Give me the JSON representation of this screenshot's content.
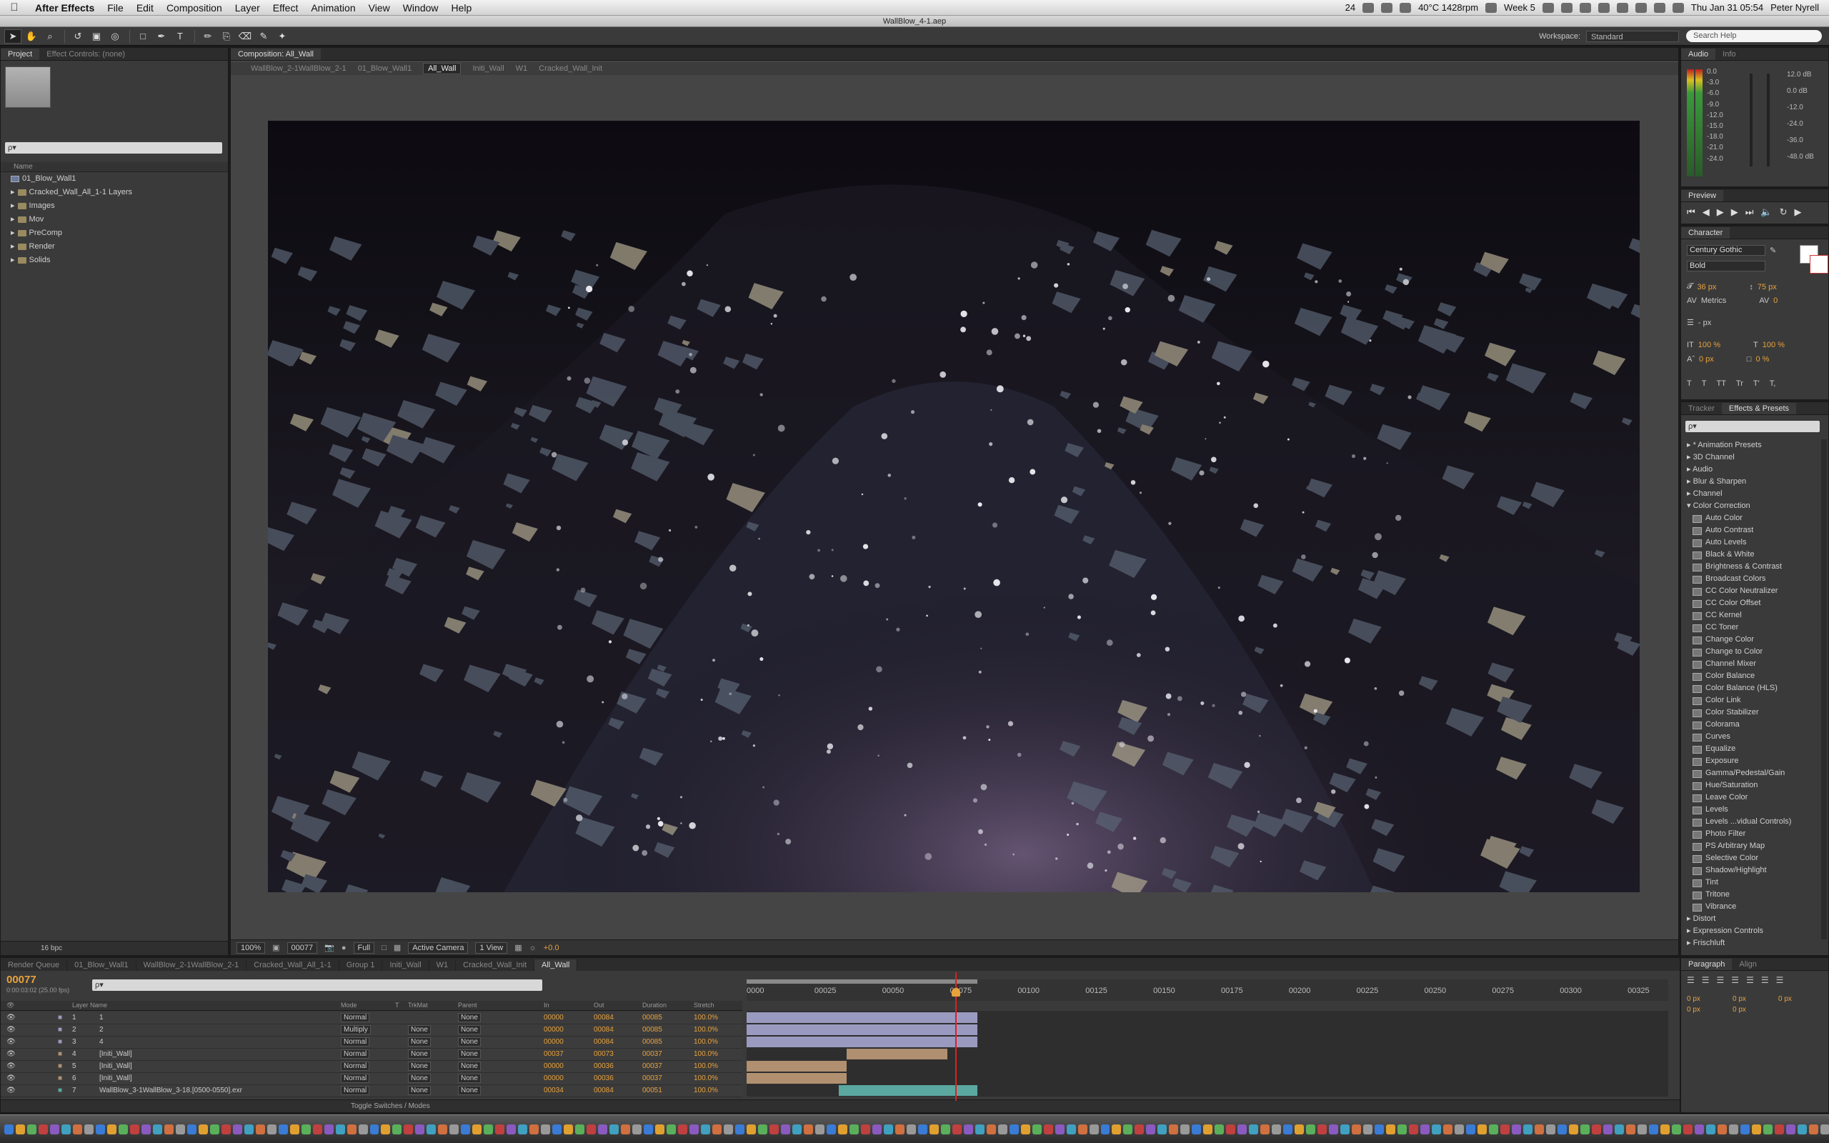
{
  "menubar": {
    "app_name": "After Effects",
    "items": [
      "File",
      "Edit",
      "Composition",
      "Layer",
      "Effect",
      "Animation",
      "View",
      "Window",
      "Help"
    ],
    "status": {
      "ai_count": "24",
      "temp": "40°C 1428rpm",
      "week": "Week 5",
      "datetime": "Thu Jan 31  05:54",
      "user": "Peter Nyrell"
    }
  },
  "window_title": "WallBlow_4-1.aep",
  "toolbar": {
    "workspace_label": "Workspace:",
    "workspace_value": "Standard",
    "help_placeholder": "Search Help"
  },
  "project": {
    "tabs": [
      "Project",
      "Effect Controls: (none)"
    ],
    "search_placeholder": "ρ▾",
    "column_name": "Name",
    "items": [
      {
        "label": "01_Blow_Wall1",
        "type": "comp"
      },
      {
        "label": "Cracked_Wall_All_1-1 Layers",
        "type": "folder"
      },
      {
        "label": "Images",
        "type": "folder"
      },
      {
        "label": "Mov",
        "type": "folder"
      },
      {
        "label": "PreComp",
        "type": "folder"
      },
      {
        "label": "Render",
        "type": "folder"
      },
      {
        "label": "Solids",
        "type": "folder"
      }
    ],
    "bpc": "16 bpc"
  },
  "comp": {
    "tab": "Composition: All_Wall",
    "breadcrumbs": [
      "WallBlow_2-1WallBlow_2-1",
      "01_Blow_Wall1",
      "All_Wall",
      "Initi_Wall",
      "W1",
      "Cracked_Wall_Init"
    ],
    "current_crumb": "All_Wall",
    "footer": {
      "zoom": "100%",
      "timecode": "00077",
      "resolution": "Full",
      "camera": "Active Camera",
      "views": "1 View",
      "exposure": "+0.0"
    }
  },
  "audio": {
    "tabs": [
      "Audio",
      "Info"
    ],
    "left_scale": [
      "0.0",
      "-3.0",
      "-6.0",
      "-9.0",
      "-12.0",
      "-15.0",
      "-18.0",
      "-21.0",
      "-24.0"
    ],
    "right_scale": [
      "12.0 dB",
      "0.0 dB",
      "-12.0",
      "-24.0",
      "-36.0",
      "-48.0 dB"
    ]
  },
  "preview": {
    "tab": "Preview"
  },
  "character": {
    "tab": "Character",
    "font": "Century Gothic",
    "style": "Bold",
    "size": "36 px",
    "leading": "75 px",
    "kerning": "Metrics",
    "tracking": "0",
    "stroke_width": "- px",
    "vscale": "100 %",
    "hscale": "100 %",
    "baseline": "0 px",
    "tsume": "0 %",
    "styles": [
      "T",
      "T",
      "TT",
      "Tr",
      "T'",
      "T,"
    ]
  },
  "effects": {
    "tabs": [
      "Tracker",
      "Effects & Presets"
    ],
    "search_placeholder": "ρ▾",
    "items": [
      {
        "label": "* Animation Presets",
        "kind": "cat"
      },
      {
        "label": "3D Channel",
        "kind": "cat"
      },
      {
        "label": "Audio",
        "kind": "cat"
      },
      {
        "label": "Blur & Sharpen",
        "kind": "cat"
      },
      {
        "label": "Channel",
        "kind": "cat"
      },
      {
        "label": "Color Correction",
        "kind": "open"
      },
      {
        "label": "Auto Color",
        "kind": "fx"
      },
      {
        "label": "Auto Contrast",
        "kind": "fx"
      },
      {
        "label": "Auto Levels",
        "kind": "fx"
      },
      {
        "label": "Black & White",
        "kind": "fx"
      },
      {
        "label": "Brightness & Contrast",
        "kind": "fx"
      },
      {
        "label": "Broadcast Colors",
        "kind": "fx"
      },
      {
        "label": "CC Color Neutralizer",
        "kind": "fx"
      },
      {
        "label": "CC Color Offset",
        "kind": "fx"
      },
      {
        "label": "CC Kernel",
        "kind": "fx"
      },
      {
        "label": "CC Toner",
        "kind": "fx"
      },
      {
        "label": "Change Color",
        "kind": "fx"
      },
      {
        "label": "Change to Color",
        "kind": "fx"
      },
      {
        "label": "Channel Mixer",
        "kind": "fx"
      },
      {
        "label": "Color Balance",
        "kind": "fx"
      },
      {
        "label": "Color Balance (HLS)",
        "kind": "fx"
      },
      {
        "label": "Color Link",
        "kind": "fx"
      },
      {
        "label": "Color Stabilizer",
        "kind": "fx"
      },
      {
        "label": "Colorama",
        "kind": "fx"
      },
      {
        "label": "Curves",
        "kind": "fx"
      },
      {
        "label": "Equalize",
        "kind": "fx"
      },
      {
        "label": "Exposure",
        "kind": "fx"
      },
      {
        "label": "Gamma/Pedestal/Gain",
        "kind": "fx"
      },
      {
        "label": "Hue/Saturation",
        "kind": "fx"
      },
      {
        "label": "Leave Color",
        "kind": "fx"
      },
      {
        "label": "Levels",
        "kind": "fx"
      },
      {
        "label": "Levels ...vidual Controls)",
        "kind": "fx"
      },
      {
        "label": "Photo Filter",
        "kind": "fx"
      },
      {
        "label": "PS Arbitrary Map",
        "kind": "fx"
      },
      {
        "label": "Selective Color",
        "kind": "fx"
      },
      {
        "label": "Shadow/Highlight",
        "kind": "fx"
      },
      {
        "label": "Tint",
        "kind": "fx"
      },
      {
        "label": "Tritone",
        "kind": "fx"
      },
      {
        "label": "Vibrance",
        "kind": "fx"
      },
      {
        "label": "Distort",
        "kind": "cat"
      },
      {
        "label": "Expression Controls",
        "kind": "cat"
      },
      {
        "label": "Frischluft",
        "kind": "cat"
      }
    ]
  },
  "timeline": {
    "tabs": [
      "Render Queue",
      "01_Blow_Wall1",
      "WallBlow_2-1WallBlow_2-1",
      "Cracked_Wall_All_1-1",
      "Group 1",
      "Initi_Wall",
      "W1",
      "Cracked_Wall_Init",
      "All_Wall"
    ],
    "active_tab": "All_Wall",
    "timecode": "00077",
    "timecode_sub": "0:00:03:02 (25.00 fps)",
    "search_placeholder": "ρ▾",
    "headers": {
      "layer_name": "Layer Name",
      "mode": "Mode",
      "t": "T",
      "trkmat": "TrkMat",
      "parent": "Parent",
      "in": "In",
      "out": "Out",
      "duration": "Duration",
      "stretch": "Stretch"
    },
    "ruler": [
      "0000",
      "00025",
      "00050",
      "00075",
      "00100",
      "00125",
      "00150",
      "00175",
      "00200",
      "00225",
      "00250",
      "00275",
      "00300",
      "00325"
    ],
    "current_frame": 77,
    "work_area": [
      0,
      85
    ],
    "layers": [
      {
        "num": "1",
        "name": "1",
        "mode": "Normal",
        "trkmat": "",
        "parent": "None",
        "in": "00000",
        "out": "00084",
        "dur": "00085",
        "stretch": "100.0%",
        "color": "#9a9ac0",
        "bar": [
          0,
          85
        ]
      },
      {
        "num": "2",
        "name": "2",
        "mode": "Multiply",
        "trkmat": "None",
        "parent": "None",
        "in": "00000",
        "out": "00084",
        "dur": "00085",
        "stretch": "100.0%",
        "color": "#9a9ac0",
        "bar": [
          0,
          85
        ]
      },
      {
        "num": "3",
        "name": "4",
        "mode": "Normal",
        "trkmat": "None",
        "parent": "None",
        "in": "00000",
        "out": "00084",
        "dur": "00085",
        "stretch": "100.0%",
        "color": "#9a9ac0",
        "bar": [
          0,
          85
        ]
      },
      {
        "num": "4",
        "name": "[Initi_Wall]",
        "mode": "Normal",
        "trkmat": "None",
        "parent": "None",
        "in": "00037",
        "out": "00073",
        "dur": "00037",
        "stretch": "100.0%",
        "color": "#b09070",
        "bar": [
          37,
          74
        ]
      },
      {
        "num": "5",
        "name": "[Initi_Wall]",
        "mode": "Normal",
        "trkmat": "None",
        "parent": "None",
        "in": "00000",
        "out": "00036",
        "dur": "00037",
        "stretch": "100.0%",
        "color": "#b09070",
        "bar": [
          0,
          37
        ]
      },
      {
        "num": "6",
        "name": "[Initi_Wall]",
        "mode": "Normal",
        "trkmat": "None",
        "parent": "None",
        "in": "00000",
        "out": "00036",
        "dur": "00037",
        "stretch": "100.0%",
        "color": "#b09070",
        "bar": [
          0,
          37
        ]
      },
      {
        "num": "7",
        "name": "WallBlow_3-1WallBlow_3-18.[0500-0550].exr",
        "mode": "Normal",
        "trkmat": "None",
        "parent": "None",
        "in": "00034",
        "out": "00084",
        "dur": "00051",
        "stretch": "100.0%",
        "color": "#5aa8a0",
        "bar": [
          34,
          85
        ]
      }
    ],
    "footer": "Toggle Switches / Modes"
  },
  "paragraph": {
    "tabs": [
      "Paragraph",
      "Align"
    ],
    "values": [
      "0 px",
      "0 px",
      "0 px",
      "0 px",
      "0 px"
    ]
  }
}
